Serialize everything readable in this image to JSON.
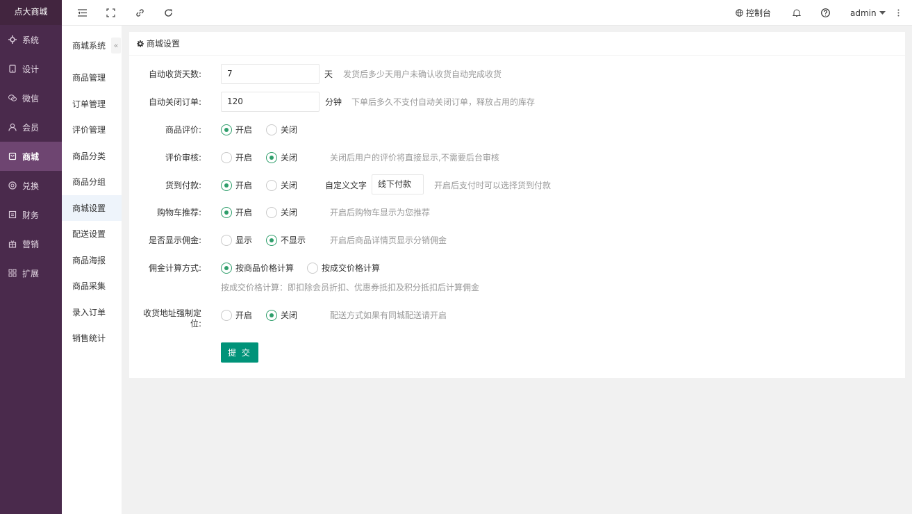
{
  "brand": "点大商城",
  "left_nav": [
    {
      "label": "系统",
      "icon": "gear-icon"
    },
    {
      "label": "设计",
      "icon": "tablet-icon"
    },
    {
      "label": "微信",
      "icon": "wechat-icon"
    },
    {
      "label": "会员",
      "icon": "user-icon"
    },
    {
      "label": "商城",
      "icon": "bag-icon",
      "active": true
    },
    {
      "label": "兑换",
      "icon": "exchange-icon"
    },
    {
      "label": "财务",
      "icon": "ledger-icon"
    },
    {
      "label": "营销",
      "icon": "gift-icon"
    },
    {
      "label": "扩展",
      "icon": "apps-icon"
    }
  ],
  "topbar": {
    "console_label": "控制台",
    "user_label": "admin"
  },
  "subnav": {
    "title": "商城系统",
    "collapse_glyph": "«",
    "items": [
      "商品管理",
      "订单管理",
      "评价管理",
      "商品分类",
      "商品分组",
      "商城设置",
      "配送设置",
      "商品海报",
      "商品采集",
      "录入订单",
      "销售统计"
    ],
    "active_index": 5
  },
  "card": {
    "title": "商城设置"
  },
  "form": {
    "auto_receive": {
      "label": "自动收货天数:",
      "value": "7",
      "unit": "天",
      "hint": "发货后多少天用户未确认收货自动完成收货"
    },
    "auto_close": {
      "label": "自动关闭订单:",
      "value": "120",
      "unit": "分钟",
      "hint": "下单后多久不支付自动关闭订单，释放占用的库存"
    },
    "review": {
      "label": "商品评价:",
      "opt1": "开启",
      "opt2": "关闭",
      "selected": 1
    },
    "review_audit": {
      "label": "评价审核:",
      "opt1": "开启",
      "opt2": "关闭",
      "selected": 2,
      "hint": "关闭后用户的评价将直接显示,不需要后台审核"
    },
    "cod": {
      "label": "货到付款:",
      "opt1": "开启",
      "opt2": "关闭",
      "selected": 1,
      "custom_label": "自定义文字",
      "custom_value": "线下付款",
      "hint": "开启后支付时可以选择货到付款"
    },
    "cart_recommend": {
      "label": "购物车推荐:",
      "opt1": "开启",
      "opt2": "关闭",
      "selected": 1,
      "hint": "开启后购物车显示为您推荐"
    },
    "show_commission": {
      "label": "是否显示佣金:",
      "opt1": "显示",
      "opt2": "不显示",
      "selected": 2,
      "hint": "开启后商品详情页显示分销佣金"
    },
    "commission_calc": {
      "label": "佣金计算方式:",
      "opt1": "按商品价格计算",
      "opt2": "按成交价格计算",
      "selected": 1,
      "note": "按成交价格计算：即扣除会员折扣、优惠券抵扣及积分抵扣后计算佣金"
    },
    "force_location": {
      "label_line1": "收货地址强制定",
      "label_line2": "位:",
      "opt1": "开启",
      "opt2": "关闭",
      "selected": 2,
      "hint": "配送方式如果有同城配送请开启"
    },
    "submit_label": "提 交"
  }
}
